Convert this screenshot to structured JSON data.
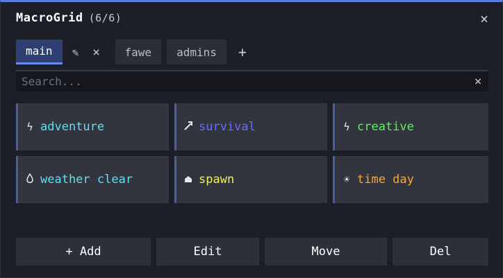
{
  "window": {
    "title": "MacroGrid",
    "count": "(6/6)",
    "close_symbol": "×",
    "accent_color": "#5b7fe0"
  },
  "tabs": {
    "items": [
      {
        "label": "main",
        "active": true
      },
      {
        "label": "fawe",
        "active": false
      },
      {
        "label": "admins",
        "active": false
      }
    ],
    "rename_icon": "pencil-icon",
    "rename_symbol": "✎",
    "delete_symbol": "×",
    "add_symbol": "+"
  },
  "search": {
    "placeholder": "Search...",
    "value": "",
    "clear_symbol": "×"
  },
  "macros": [
    {
      "label": "adventure",
      "icon": "lightning-icon",
      "symbol": "ϟ",
      "color": "#5fe0f0"
    },
    {
      "label": "survival",
      "icon": "pickaxe-icon",
      "symbol": "↗",
      "color": "#6a6cff"
    },
    {
      "label": "creative",
      "icon": "lightning-icon",
      "symbol": "ϟ",
      "color": "#5cf05c"
    },
    {
      "label": "weather clear",
      "icon": "droplet-icon",
      "symbol": "💧",
      "color": "#5fe0f0"
    },
    {
      "label": "spawn",
      "icon": "home-icon",
      "symbol": "⌂",
      "color": "#f0f05a"
    },
    {
      "label": "time day",
      "icon": "sun-icon",
      "symbol": "☀",
      "color": "#ffa629"
    }
  ],
  "buttons": {
    "add": "+ Add",
    "edit": "Edit",
    "move": "Move",
    "del": "Del"
  }
}
